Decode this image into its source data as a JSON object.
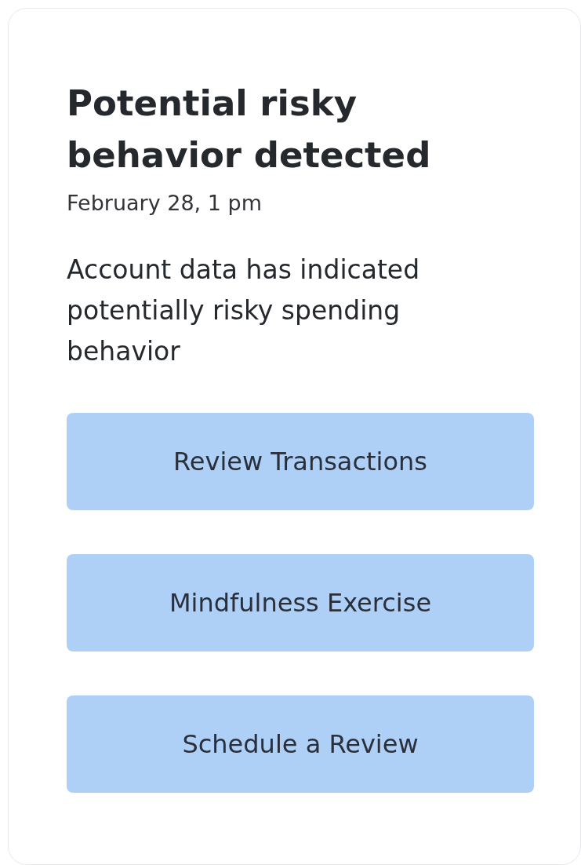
{
  "card": {
    "title": "Potential risky behavior detected",
    "timestamp": "February 28, 1 pm",
    "message": "Account data has indicated potentially risky spending behavior",
    "actions": [
      {
        "label": "Review Transactions"
      },
      {
        "label": "Mindfulness Exercise"
      },
      {
        "label": "Schedule a Review"
      }
    ]
  }
}
